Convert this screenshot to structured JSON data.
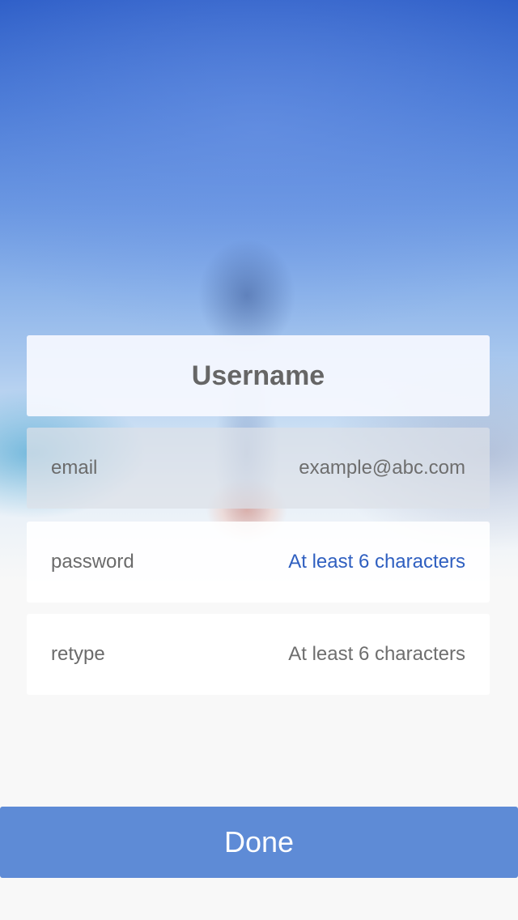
{
  "header": {
    "title": "Username"
  },
  "form": {
    "email": {
      "label": "email",
      "placeholder": "example@abc.com"
    },
    "password": {
      "label": "password",
      "placeholder": "At least 6 characters"
    },
    "retype": {
      "label": "retype",
      "placeholder": "At least 6 characters"
    }
  },
  "actions": {
    "done_label": "Done"
  },
  "colors": {
    "accent": "#5e8bd6",
    "active_placeholder": "#2f5fc0",
    "text_gray": "#6b6b6b",
    "page_background": "#f8f8f8"
  }
}
